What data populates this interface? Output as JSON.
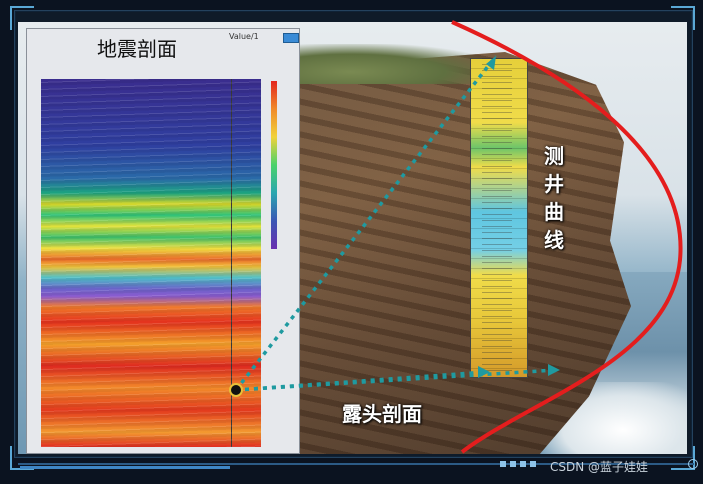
{
  "seismic_panel": {
    "title": "地震剖面",
    "subtitle": "Value/1"
  },
  "labels": {
    "outcrop": "露头剖面",
    "well_log": "测井曲线"
  },
  "watermark": "CSDN @蓝子娃娃",
  "colors": {
    "curve_red": "#e41d1d",
    "arrow_teal": "#1f9aa0",
    "frame_blue": "#3f86c4"
  },
  "icons": [
    "pin-marker-icon",
    "colorbar-icon"
  ]
}
